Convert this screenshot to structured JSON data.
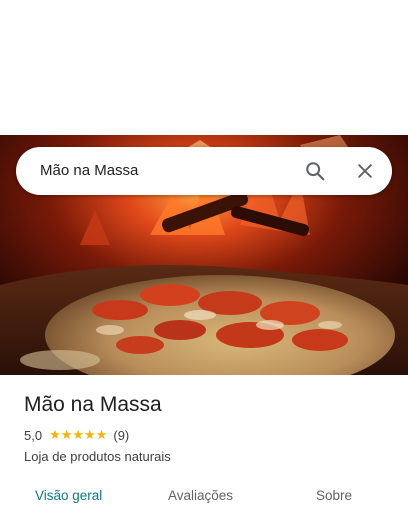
{
  "search": {
    "query": "Mão na Massa"
  },
  "icons": {
    "search": "search-icon",
    "close": "close-icon"
  },
  "hero": {
    "subject": "pizza-in-wood-oven-photo"
  },
  "place": {
    "name": "Mão na Massa",
    "rating": "5,0",
    "stars": "★★★★★",
    "star_count": 5,
    "review_count": "(9)",
    "category": "Loja de produtos naturais"
  },
  "tabs": [
    {
      "label": "Visão geral",
      "active": true
    },
    {
      "label": "Avaliações",
      "active": false
    },
    {
      "label": "Sobre",
      "active": false
    }
  ],
  "colors": {
    "accent": "#0b7a87",
    "star": "#f4b400",
    "text_primary": "#202124",
    "text_secondary": "#5f6368"
  }
}
